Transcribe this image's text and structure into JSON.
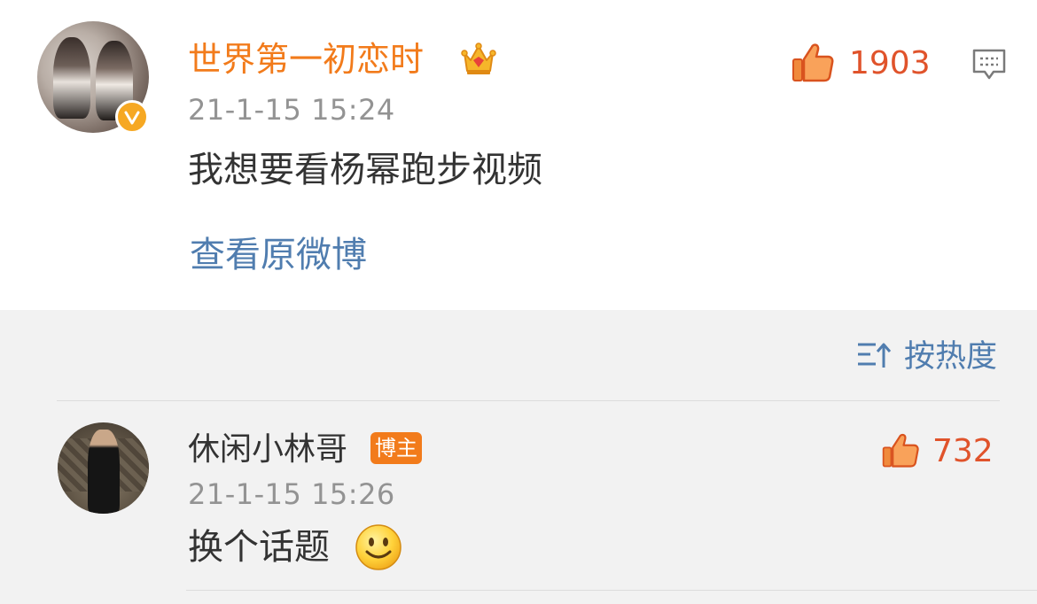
{
  "post": {
    "username": "世界第一初恋时",
    "timestamp": "21-1-15 15:24",
    "text": "我想要看杨幂跑步视频",
    "view_original": "查看原微博",
    "like_count": "1903",
    "icons": {
      "avatar": "avatar-image",
      "verified": "verified-v-badge",
      "crown": "crown-icon",
      "like": "thumbs-up-icon",
      "comment": "comment-bubble-icon"
    }
  },
  "comments": {
    "sort_label": "按热度",
    "sort_icon": "sort-lines-arrow-icon",
    "items": [
      {
        "username": "休闲小林哥",
        "badge": "博主",
        "timestamp": "21-1-15 15:26",
        "text": "换个话题",
        "emoji": "smile-emoji-icon",
        "like_count": "732"
      }
    ]
  },
  "colors": {
    "username_orange": "#f27b1b",
    "link_blue": "#507daf",
    "like_red": "#e0532b",
    "timestamp_gray": "#939393",
    "text_dark": "#333333",
    "comments_bg": "#f2f2f2",
    "badge_orange": "#f27b1b"
  }
}
